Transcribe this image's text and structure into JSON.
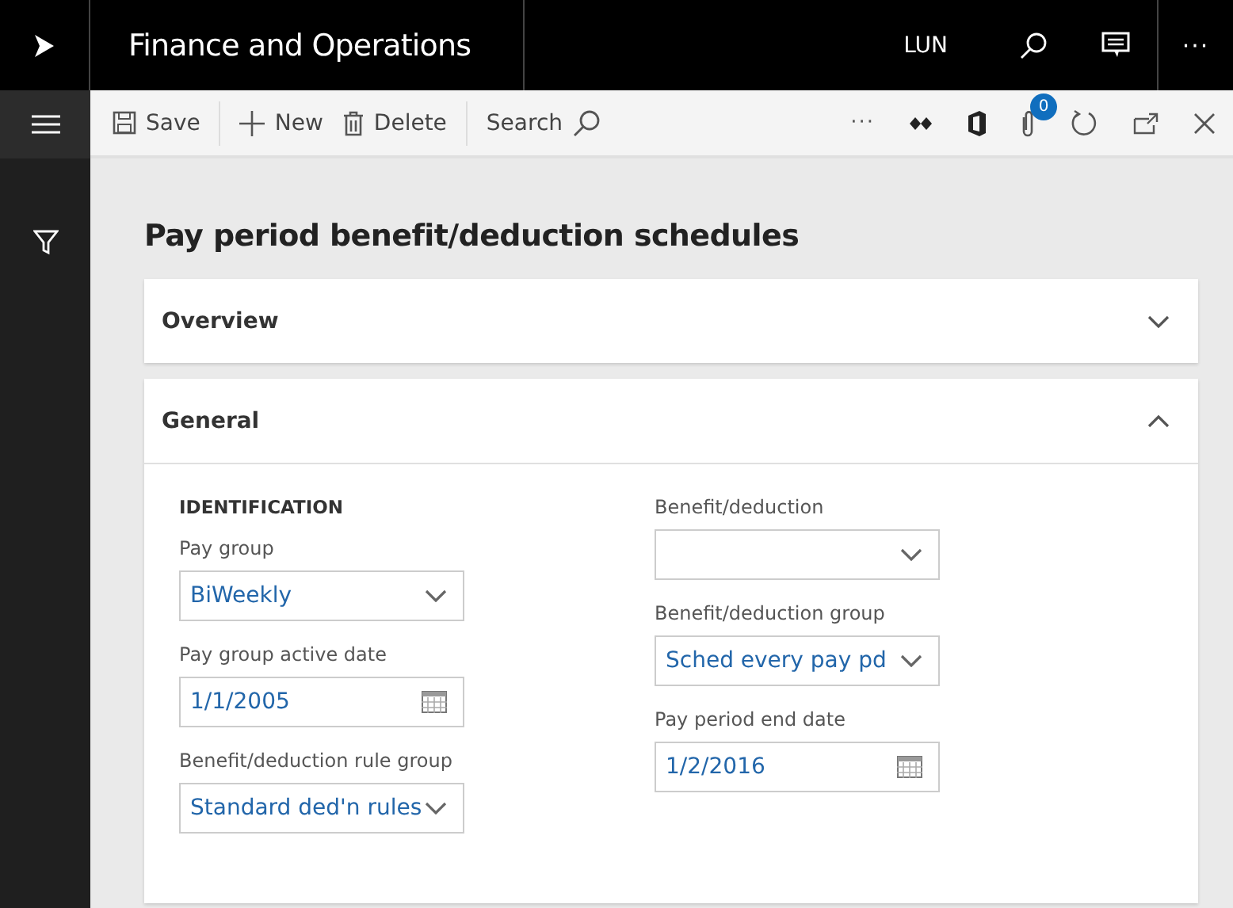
{
  "app": {
    "title": "Finance and Operations",
    "company": "LUN",
    "more": "···"
  },
  "toolbar": {
    "buttons": [
      {
        "kind": "save",
        "label": "Save"
      },
      {
        "kind": "new",
        "label": "New"
      },
      {
        "kind": "delete",
        "label": "Delete"
      }
    ],
    "search_label": "Search",
    "more": "···",
    "attachment_count": "0"
  },
  "page_title": "Pay period benefit/deduction schedules",
  "sections": [
    {
      "title": "Overview",
      "expanded": false
    },
    {
      "title": "General",
      "expanded": true
    }
  ],
  "general": {
    "group_heading": "IDENTIFICATION",
    "columns": [
      [
        {
          "label": "Pay group",
          "kind": "lookup",
          "value": "BiWeekly"
        },
        {
          "label": "Pay group active date",
          "kind": "date",
          "value": "1/1/2005"
        },
        {
          "label": "Benefit/deduction rule group",
          "kind": "lookup",
          "value": "Standard ded'n rules"
        }
      ],
      [
        {
          "label": "Benefit/deduction",
          "kind": "lookup"
        },
        {
          "label": "Benefit/deduction group",
          "kind": "lookup",
          "value": "Sched every pay pd"
        },
        {
          "label": "Pay period end date",
          "kind": "date",
          "value": "1/2/2016"
        }
      ]
    ]
  }
}
